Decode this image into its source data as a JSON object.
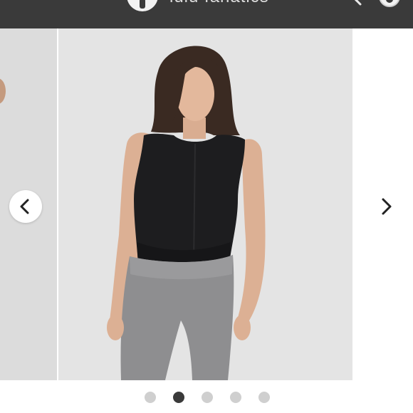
{
  "header": {
    "brand": "lulu fanatics",
    "menu_icon": "menu-icon",
    "logo_icon": "logo-icon",
    "search_icon": "search-icon",
    "profile_icon": "profile-icon"
  },
  "carousel": {
    "prev_icon": "chevron-left-icon",
    "next_icon": "chevron-right-icon",
    "slide_count": 5,
    "active_index": 1
  },
  "colors": {
    "header_bg": "#3a3a3a",
    "dot_active": "#3a3a3a",
    "dot_inactive": "#cfcfcf"
  }
}
